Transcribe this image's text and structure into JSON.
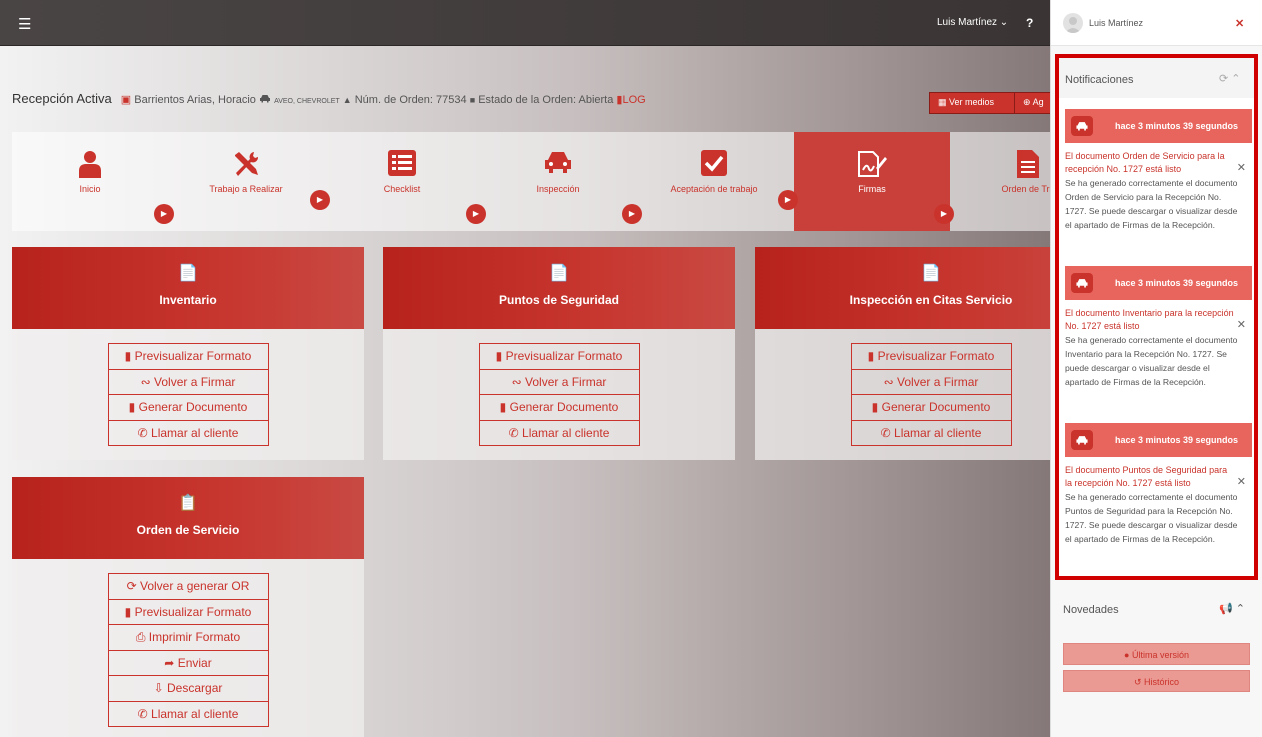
{
  "navbar": {
    "menu_icon": "hamburger-icon",
    "user_name": "Luis Martínez",
    "help_label": "?"
  },
  "header": {
    "title": "Recepción Activa",
    "client": "Barrientos Arias, Horacio",
    "vehicle_model": "AVEO, CHEVROLET",
    "order_label": "Núm. de Orden:",
    "order_number": "77534",
    "status_label": "Estado de la Orden:",
    "status_value": "Abierta",
    "log_label": "LOG",
    "ver_medios": "Ver medios",
    "agregar": "Ag"
  },
  "steps": [
    {
      "label": "Inicio",
      "icon": "user-icon"
    },
    {
      "label": "Trabajo a Realizar",
      "icon": "tools-icon"
    },
    {
      "label": "Checklist",
      "icon": "checklist-icon"
    },
    {
      "label": "Inspección",
      "icon": "car-icon"
    },
    {
      "label": "Aceptación de trabajo",
      "icon": "check-square-icon"
    },
    {
      "label": "Firmas",
      "icon": "signature-icon",
      "active": true
    },
    {
      "label": "Orden de Tra",
      "icon": "document-icon"
    }
  ],
  "cards": [
    {
      "title": "Inventario",
      "actions": [
        "Previsualizar Formato",
        "Volver a Firmar",
        "Generar Documento",
        "Llamar al cliente"
      ]
    },
    {
      "title": "Puntos de Seguridad",
      "actions": [
        "Previsualizar Formato",
        "Volver a Firmar",
        "Generar Documento",
        "Llamar al cliente"
      ]
    },
    {
      "title": "Inspección en Citas Servicio",
      "actions": [
        "Previsualizar Formato",
        "Volver a Firmar",
        "Generar Documento",
        "Llamar al cliente"
      ]
    },
    {
      "title": "Orden de Servicio",
      "actions": [
        "Volver a generar OR",
        "Previsualizar Formato",
        "Imprimir Formato",
        "Enviar",
        "Descargar",
        "Llamar al cliente"
      ]
    }
  ],
  "panel": {
    "user_name": "Luis Martínez",
    "notifications_title": "Notificaciones",
    "notifications": [
      {
        "time": "hace 3 minutos 39 segundos",
        "heading": "El documento Orden de Servicio para la recepción No. 1727 está listo",
        "body": "Se ha generado correctamente el documento Orden de Servicio para la Recepción No. 1727. Se puede descargar o visualizar desde el apartado de Firmas de la Recepción."
      },
      {
        "time": "hace 3 minutos 39 segundos",
        "heading": "El documento Inventario para la recepción No. 1727 está listo",
        "body": "Se ha generado correctamente el documento Inventario para la Recepción No. 1727. Se puede descargar o visualizar desde el apartado de Firmas de la Recepción."
      },
      {
        "time": "hace 3 minutos 39 segundos",
        "heading": "El documento Puntos de Seguridad para la recepción No. 1727 está listo",
        "body": "Se ha generado correctamente el documento Puntos de Seguridad para la Recepción No. 1727. Se puede descargar o visualizar desde el apartado de Firmas de la Recepción."
      }
    ],
    "novedades_title": "Novedades",
    "ultima_version": "Última versión",
    "historico": "Histórico"
  },
  "colors": {
    "accent": "#c9332b",
    "accent_light": "#e8655d",
    "highlight_border": "#d10000"
  }
}
